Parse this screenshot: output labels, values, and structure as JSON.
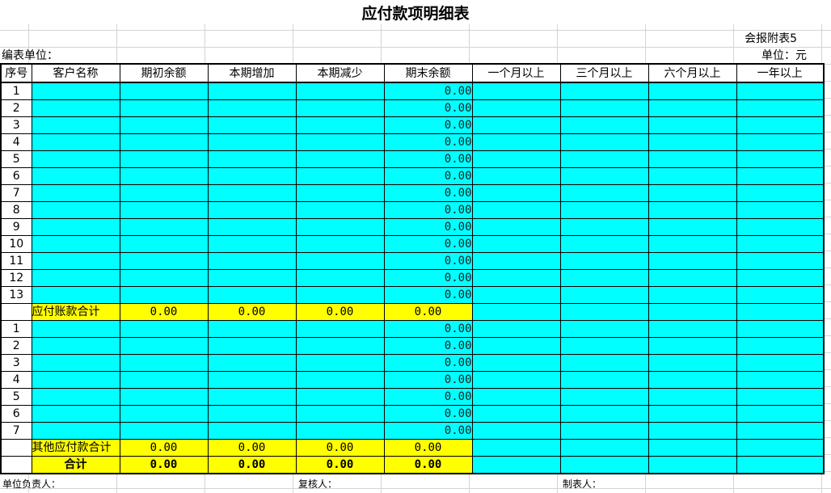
{
  "title": "应付款项明细表",
  "attachment": "会报附表5",
  "org_label": "编表单位：",
  "unit_label": "单位：元",
  "columns": [
    "序号",
    "客户名称",
    "期初余额",
    "本期增加",
    "本期减少",
    "期末余额",
    "一个月以上",
    "三个月以上",
    "六个月以上",
    "一年以上"
  ],
  "payables_rows": [
    {
      "no": "1",
      "end": "0.00"
    },
    {
      "no": "2",
      "end": "0.00"
    },
    {
      "no": "3",
      "end": "0.00"
    },
    {
      "no": "4",
      "end": "0.00"
    },
    {
      "no": "5",
      "end": "0.00"
    },
    {
      "no": "6",
      "end": "0.00"
    },
    {
      "no": "7",
      "end": "0.00"
    },
    {
      "no": "8",
      "end": "0.00"
    },
    {
      "no": "9",
      "end": "0.00"
    },
    {
      "no": "10",
      "end": "0.00"
    },
    {
      "no": "11",
      "end": "0.00"
    },
    {
      "no": "12",
      "end": "0.00"
    },
    {
      "no": "13",
      "end": "0.00"
    }
  ],
  "payables_subtotal": {
    "label": "应付账款合计",
    "opening": "0.00",
    "increase": "0.00",
    "decrease": "0.00",
    "closing": "0.00"
  },
  "other_rows": [
    {
      "no": "1",
      "end": "0.00"
    },
    {
      "no": "2",
      "end": "0.00"
    },
    {
      "no": "3",
      "end": "0.00"
    },
    {
      "no": "4",
      "end": "0.00"
    },
    {
      "no": "5",
      "end": "0.00"
    },
    {
      "no": "6",
      "end": "0.00"
    },
    {
      "no": "7",
      "end": "0.00"
    }
  ],
  "other_subtotal": {
    "label": "其他应付款合计",
    "opening": "0.00",
    "increase": "0.00",
    "decrease": "0.00",
    "closing": "0.00"
  },
  "grand_total": {
    "label": "合计",
    "opening": "0.00",
    "increase": "0.00",
    "decrease": "0.00",
    "closing": "0.00"
  },
  "footer": {
    "responsible": "单位负责人：",
    "reviewer": "复核人：",
    "preparer": "制表人："
  },
  "colors": {
    "cell_fill": "#00ffff",
    "subtotal_fill": "#ffff00"
  }
}
